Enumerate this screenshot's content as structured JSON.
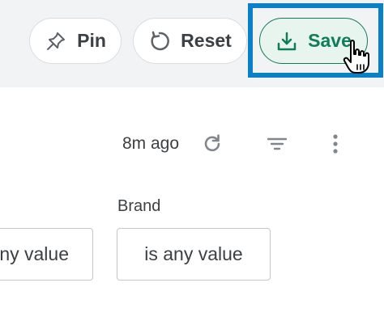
{
  "toolbar": {
    "pin_label": "Pin",
    "reset_label": "Reset",
    "save_label": "Save",
    "pin_icon": "pin-icon",
    "reset_icon": "reset-icon",
    "save_icon": "download-icon"
  },
  "meta": {
    "last_run": "8m ago"
  },
  "filters": [
    {
      "label": "",
      "value": "is any value"
    },
    {
      "label": "Brand",
      "value": "is any value"
    }
  ],
  "colors": {
    "accent": "#0f7c5a",
    "highlight": "#0a80c9",
    "toolbar_bg": "#f1f3f4",
    "text": "#3c4043"
  }
}
